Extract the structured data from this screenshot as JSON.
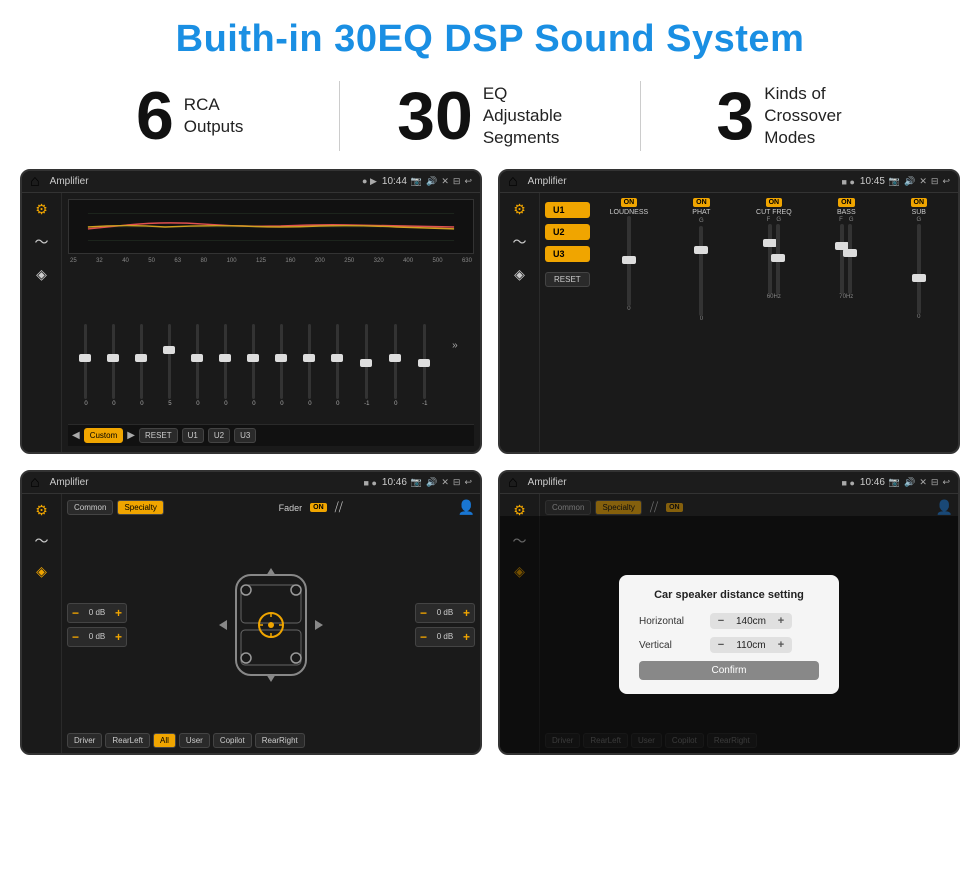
{
  "title": "Buith-in 30EQ DSP Sound System",
  "stats": [
    {
      "number": "6",
      "label": "RCA\nOutputs"
    },
    {
      "number": "30",
      "label": "EQ Adjustable\nSegments"
    },
    {
      "number": "3",
      "label": "Kinds of\nCrossover Modes"
    }
  ],
  "screen1": {
    "appName": "Amplifier",
    "time": "10:44",
    "freqLabels": [
      "25",
      "32",
      "40",
      "50",
      "63",
      "80",
      "100",
      "125",
      "160",
      "200",
      "250",
      "320",
      "400",
      "500",
      "630"
    ],
    "sliderValues": [
      "0",
      "0",
      "0",
      "5",
      "0",
      "0",
      "0",
      "0",
      "0",
      "0",
      "-1",
      "0",
      "-1"
    ],
    "bottomBtns": [
      "Custom",
      "RESET",
      "U1",
      "U2",
      "U3"
    ]
  },
  "screen2": {
    "appName": "Amplifier",
    "time": "10:45",
    "uButtons": [
      "U1",
      "U2",
      "U3"
    ],
    "channels": [
      "LOUDNESS",
      "PHAT",
      "CUT FREQ",
      "BASS",
      "SUB"
    ],
    "resetLabel": "RESET"
  },
  "screen3": {
    "appName": "Amplifier",
    "time": "10:46",
    "tabs": [
      "Common",
      "Specialty"
    ],
    "faderLabel": "Fader",
    "onLabel": "ON",
    "volControls": [
      {
        "value": "0 dB"
      },
      {
        "value": "0 dB"
      },
      {
        "value": "0 dB"
      },
      {
        "value": "0 dB"
      }
    ],
    "bottomBtns": [
      "Driver",
      "RearLeft",
      "All",
      "User",
      "Copilot",
      "RearRight"
    ]
  },
  "screen4": {
    "appName": "Amplifier",
    "time": "10:46",
    "tabs": [
      "Common",
      "Specialty"
    ],
    "dialog": {
      "title": "Car speaker distance setting",
      "rows": [
        {
          "label": "Horizontal",
          "value": "140cm"
        },
        {
          "label": "Vertical",
          "value": "110cm"
        }
      ],
      "confirmLabel": "Confirm"
    },
    "bottomBtns": [
      "Driver",
      "RearLeft",
      "All",
      "User",
      "Copilot",
      "RearRight"
    ]
  }
}
